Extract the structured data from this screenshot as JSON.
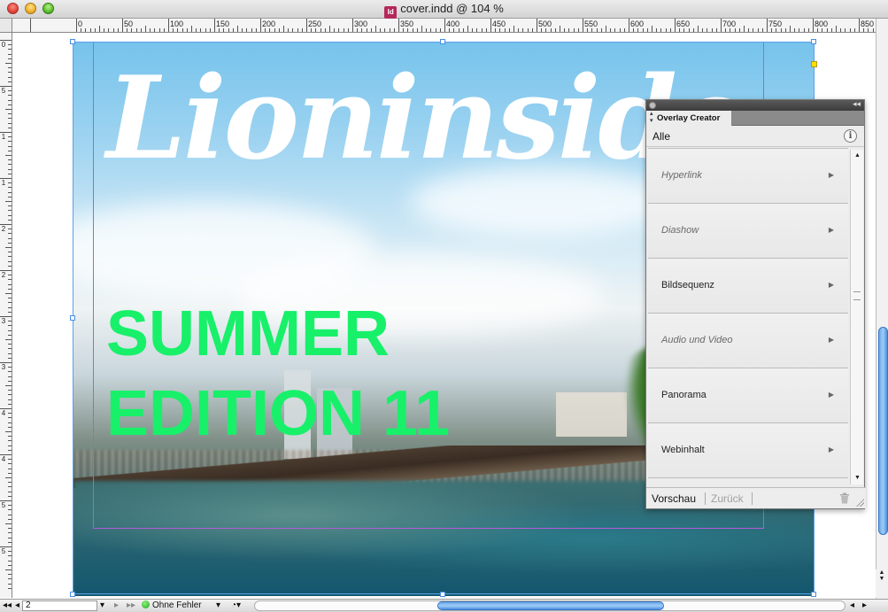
{
  "window": {
    "title": "cover.indd @ 104 %",
    "doc_icon_text": "Id"
  },
  "ruler": {
    "h_labels": [
      "0",
      "50",
      "100",
      "150",
      "200",
      "250",
      "300",
      "350",
      "400",
      "450",
      "500",
      "550",
      "600",
      "650",
      "700",
      "750",
      "800",
      "850"
    ],
    "v_labels": [
      "0",
      "5",
      "1",
      "1",
      "2",
      "2",
      "3",
      "3",
      "4",
      "4",
      "5",
      "5"
    ]
  },
  "cover": {
    "logo": "Lioninside",
    "headline_line1": "SUMMER",
    "headline_line2": "EDITION 11"
  },
  "panel": {
    "title": "Overlay Creator",
    "filter": "Alle",
    "items": [
      {
        "label": "Hyperlink",
        "enabled": false
      },
      {
        "label": "Diashow",
        "enabled": false
      },
      {
        "label": "Bildsequenz",
        "enabled": true
      },
      {
        "label": "Audio und Video",
        "enabled": false
      },
      {
        "label": "Panorama",
        "enabled": true
      },
      {
        "label": "Webinhalt",
        "enabled": true
      }
    ],
    "footer": {
      "preview": "Vorschau",
      "back": "Zurück"
    }
  },
  "status": {
    "page": "2",
    "preflight": "Ohne Fehler"
  },
  "colors": {
    "headline": "#18f06a",
    "margin_guide": "#b65bd8",
    "selection": "#5aa0e8"
  }
}
